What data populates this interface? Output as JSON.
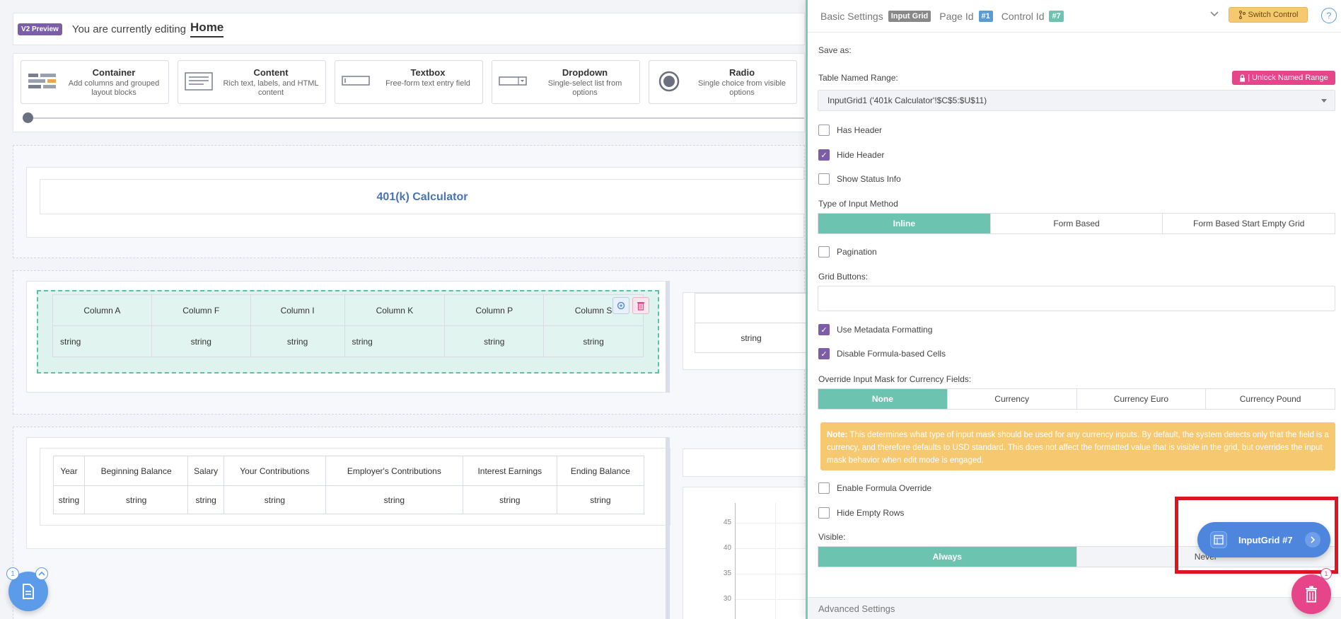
{
  "topbar": {
    "badge": "V2 Preview",
    "editing_label": "You are currently editing",
    "page_name": "Home"
  },
  "palette": [
    {
      "title": "Container",
      "desc": "Add columns and grouped layout blocks",
      "icon": "container-icon"
    },
    {
      "title": "Content",
      "desc": "Rich text, labels, and HTML content",
      "icon": "content-icon"
    },
    {
      "title": "Textbox",
      "desc": "Free-form text entry field",
      "icon": "textbox-icon"
    },
    {
      "title": "Dropdown",
      "desc": "Single-select list from options",
      "icon": "dropdown-icon"
    },
    {
      "title": "Radio",
      "desc": "Single choice from visible options",
      "icon": "radio-icon"
    }
  ],
  "canvas": {
    "calc_title": "401(k) Calculator",
    "grid1": {
      "headers": [
        "Column A",
        "Column F",
        "Column I",
        "Column K",
        "Column P",
        "Column S"
      ],
      "row": [
        "string",
        "string",
        "string",
        "string",
        "string",
        "string"
      ]
    },
    "grid_right": {
      "row": [
        "string"
      ]
    },
    "grid2": {
      "headers": [
        "Year",
        "Beginning Balance",
        "Salary",
        "Your Contributions",
        "Employer's Contributions",
        "Interest Earnings",
        "Ending Balance"
      ],
      "row": [
        "string",
        "string",
        "string",
        "string",
        "string",
        "string",
        "string"
      ]
    },
    "y_ticks": [
      "45",
      "40",
      "35",
      "30"
    ]
  },
  "panel": {
    "title": "Basic Settings",
    "type_tag": "Input Grid",
    "page_id_label": "Page Id",
    "page_id": "#1",
    "control_id_label": "Control Id",
    "control_id": "#7",
    "switch_control": "Switch Control",
    "help": "?",
    "save_as": "Save as:",
    "named_range_label": "Table Named Range:",
    "unlock_btn": "| Unlock Named Range",
    "named_range_value": "InputGrid1 ('401k Calculator'!$C$5:$U$11)",
    "has_header": "Has Header",
    "hide_header": "Hide Header",
    "show_status": "Show Status Info",
    "input_method_label": "Type of Input Method",
    "input_methods": [
      "Inline",
      "Form Based",
      "Form Based Start Empty Grid"
    ],
    "pagination": "Pagination",
    "grid_buttons_label": "Grid Buttons:",
    "use_metadata": "Use Metadata Formatting",
    "disable_formula": "Disable Formula-based Cells",
    "override_mask_label": "Override Input Mask for Currency Fields:",
    "masks": [
      "None",
      "Currency",
      "Currency Euro",
      "Currency Pound"
    ],
    "note_prefix": "Note:",
    "note_text": " This determines what type of input mask should be used for any currency inputs. By default, the system detects only that the field is a currency, and therefore defaults to USD standard. This does not affect the formatted value that is visible in the grid, but overrides the input mask behavior when edit mode is engaged.",
    "enable_formula_override": "Enable Formula Override",
    "hide_empty_rows": "Hide Empty Rows",
    "visible_label": "Visible:",
    "visible_options": [
      "Always",
      "Never"
    ],
    "advanced": "Advanced Settings"
  },
  "floating": {
    "pill_label": "InputGrid #7",
    "trash_badge": "1",
    "doc_badge": "1"
  },
  "colors": {
    "accent_green": "#6cc4b0",
    "accent_purple": "#7b5ea7",
    "accent_pink": "#e6458a",
    "accent_blue": "#4e86de",
    "highlight_red": "#e0141e",
    "note_yellow": "#f6c971"
  }
}
